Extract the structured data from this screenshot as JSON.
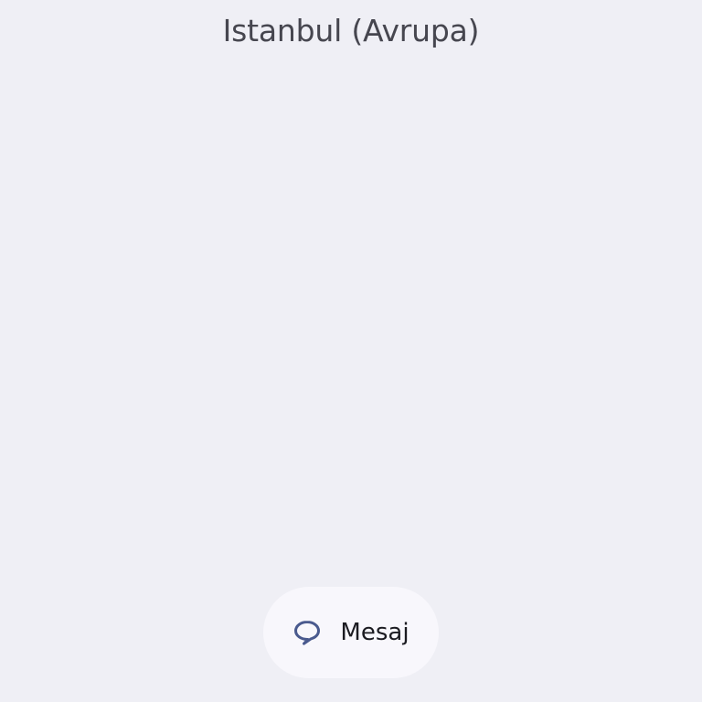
{
  "header": {
    "location": "Istanbul (Avrupa)"
  },
  "actions": {
    "message_label": "Mesaj",
    "message_icon": "chat-bubble-icon"
  },
  "colors": {
    "background": "#efeff5",
    "button_background": "#f8f7fc",
    "icon_accent": "#4a5a8e",
    "title_text": "#46464f",
    "label_text": "#1b1b21"
  }
}
